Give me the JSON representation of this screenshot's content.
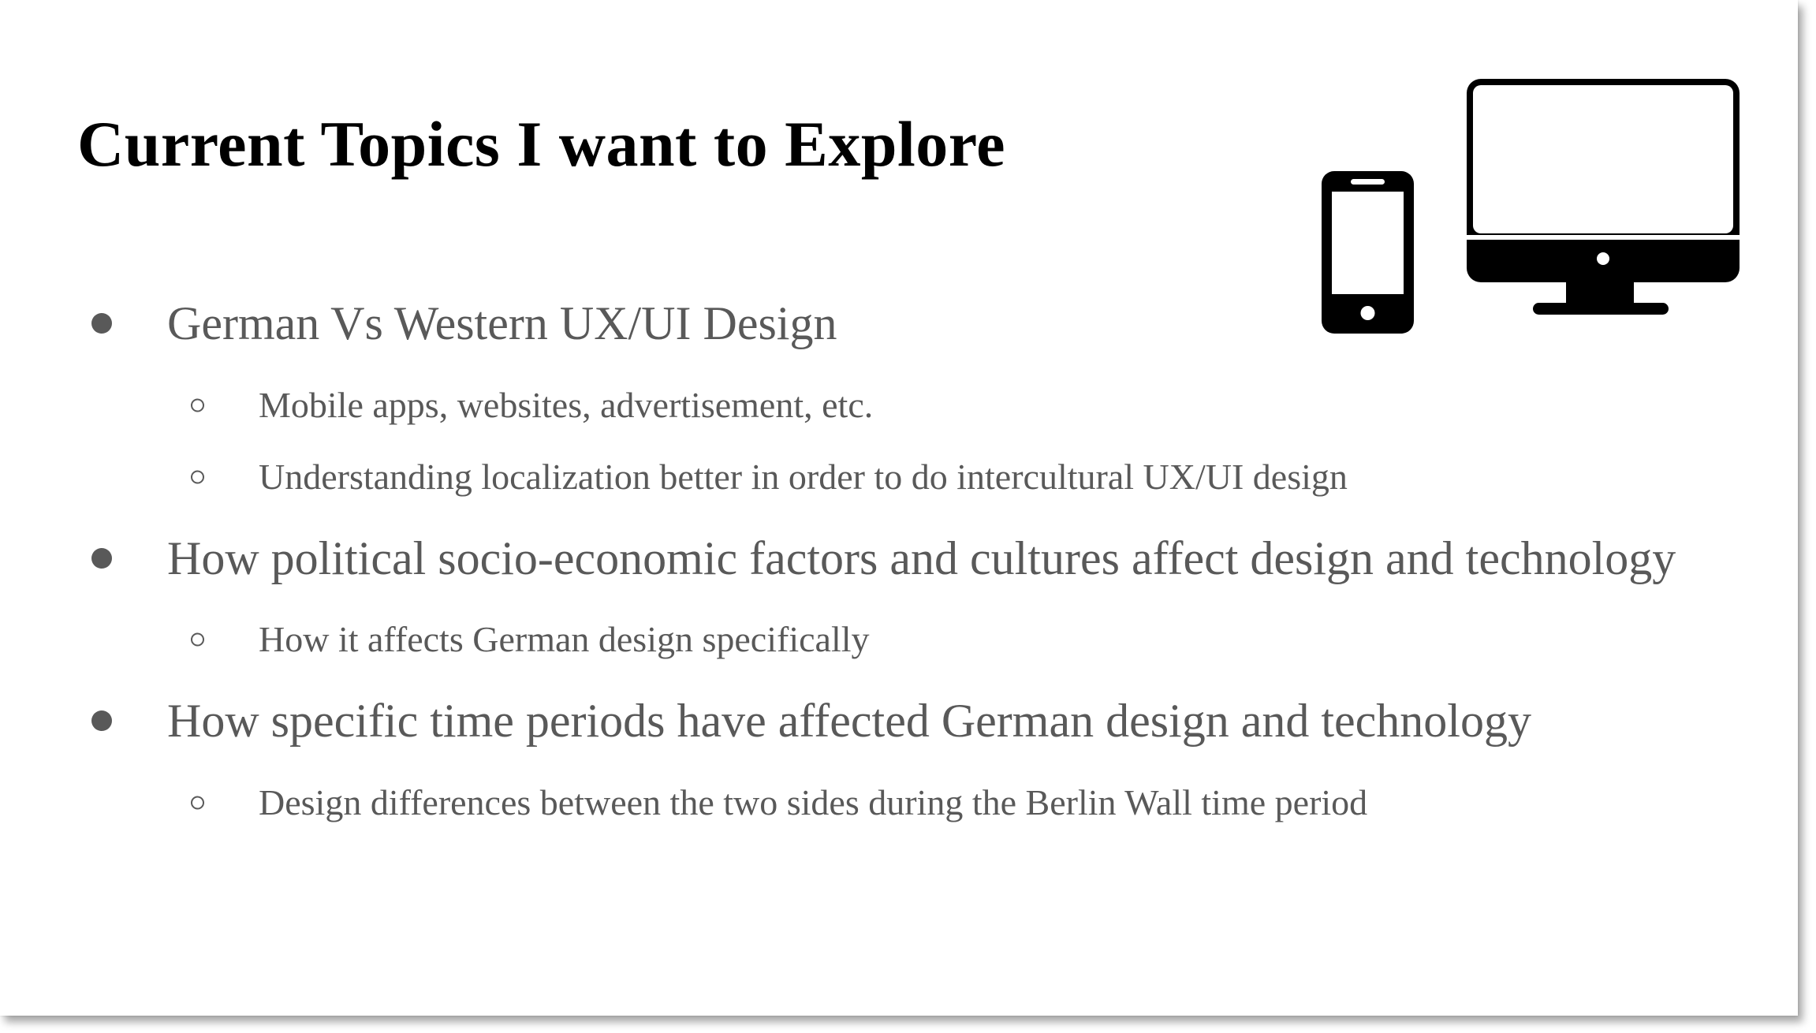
{
  "slide": {
    "title": "Current Topics I want to Explore",
    "icons": [
      "smartphone-icon",
      "desktop-monitor-icon"
    ],
    "bullets": [
      {
        "text": "German Vs Western UX/UI Design",
        "subitems": [
          "Mobile apps, websites, advertisement, etc.",
          "Understanding localization better in order to do intercultural UX/UI design"
        ]
      },
      {
        "text": "How political socio-economic factors and cultures affect design and technology",
        "subitems": [
          "How it affects German design specifically"
        ]
      },
      {
        "text": "How specific time periods have affected German design and technology",
        "subitems": [
          "Design differences between the two sides during the Berlin Wall time period"
        ]
      }
    ]
  },
  "colors": {
    "title": "#000000",
    "body_text": "#595959",
    "icons": "#000000",
    "background": "#ffffff"
  }
}
